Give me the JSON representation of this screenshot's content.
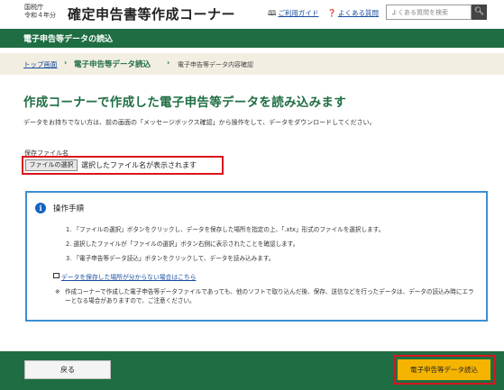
{
  "header": {
    "agency_line1": "国税庁",
    "agency_line2": "令和４年分",
    "title": "確定申告書等作成コーナー",
    "guide_link": "ご利用ガイド",
    "faq_link": "よくある質問",
    "search_placeholder": "よくある質問を検索"
  },
  "section_bar": {
    "title": "電子申告等データの読込"
  },
  "breadcrumb": {
    "top": "トップ画面",
    "current_section": "電子申告等データ読込",
    "current_page": "電子申告等データ内容確認",
    "separator": "›"
  },
  "main": {
    "heading": "作成コーナーで作成した電子申告等データを読み込みます",
    "intro": "データをお持ちでない方は、前の画面の「メッセージボックス確認」から操作をして、データをダウンロードしてください。",
    "file_label": "保存ファイル名",
    "file_button": "ファイルの選択",
    "file_text": "選択したファイル名が表示されます"
  },
  "procedure": {
    "title": "操作手順",
    "steps": [
      "1. 「ファイルの選択」ボタンをクリックし、データを保存した場所を指定の上、「.xtx」形式のファイルを選択します。",
      "2. 選択したファイルが「ファイルの選択」ボタン右側に表示されたことを確認します。",
      "3. 「電子申告等データ読込」ボタンをクリックして、データを読み込みます。"
    ],
    "help_link": "データを保存した場所が分からない場合はこちら",
    "note_mark": "※",
    "note": "作成コーナーで作成した電子申告等データファイルであっても、他のソフトで取り込んだ後、保存、送信などを行ったデータは、データの読込み時にエラーとなる場合がありますので、ご注意ください。"
  },
  "footer": {
    "back_button": "戻る",
    "load_button": "電子申告等データ読込"
  },
  "icons": {
    "guide": "book-icon",
    "faq": "question-circle-icon",
    "search": "search-icon",
    "info": "info-icon",
    "help": "window-icon"
  },
  "colors": {
    "brand_green": "#1f6e43",
    "highlight_red": "#d9141e",
    "info_blue": "#3b8fd4",
    "load_button": "#f5b400"
  }
}
